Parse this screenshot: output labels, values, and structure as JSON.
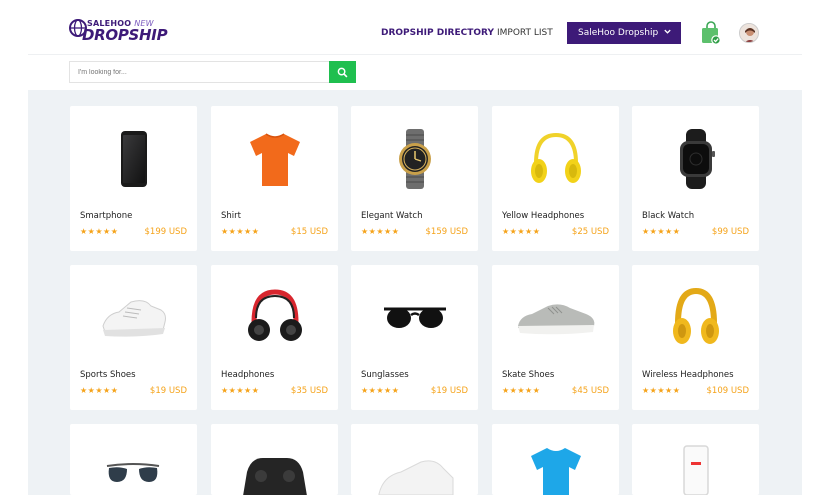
{
  "header": {
    "logo_top": "SALEHOO",
    "logo_top_new": "NEW",
    "logo_main": "DROPSHIP",
    "nav_directory": "DROPSHIP DIRECTORY",
    "nav_import": "IMPORT LIST",
    "dropdown_label": "SaleHoo Dropship"
  },
  "search": {
    "placeholder": "I'm looking for..."
  },
  "products": [
    {
      "name": "Smartphone",
      "price": "$199 USD",
      "stars": "★★★★★",
      "icon": "smartphone"
    },
    {
      "name": "Shirt",
      "price": "$15 USD",
      "stars": "★★★★★",
      "icon": "tshirt-orange"
    },
    {
      "name": "Elegant Watch",
      "price": "$159 USD",
      "stars": "★★★★★",
      "icon": "wrist-watch"
    },
    {
      "name": "Yellow Headphones",
      "price": "$25 USD",
      "stars": "★★★★★",
      "icon": "headphones-yellow"
    },
    {
      "name": "Black Watch",
      "price": "$99 USD",
      "stars": "★★★★★",
      "icon": "smart-watch"
    },
    {
      "name": "Sports Shoes",
      "price": "$19 USD",
      "stars": "★★★★★",
      "icon": "sneaker-white"
    },
    {
      "name": "Headphones",
      "price": "$35 USD",
      "stars": "★★★★★",
      "icon": "headphones-black-red"
    },
    {
      "name": "Sunglasses",
      "price": "$19 USD",
      "stars": "★★★★★",
      "icon": "sunglasses"
    },
    {
      "name": "Skate Shoes",
      "price": "$45 USD",
      "stars": "★★★★★",
      "icon": "sneaker-grey"
    },
    {
      "name": "Wireless Headphones",
      "price": "$109 USD",
      "stars": "★★★★★",
      "icon": "headphones-gold"
    }
  ],
  "colors": {
    "brand": "#3d1a78",
    "accent_green": "#1fbf4f",
    "price_orange": "#f5a31a",
    "background": "#eef2f5"
  }
}
